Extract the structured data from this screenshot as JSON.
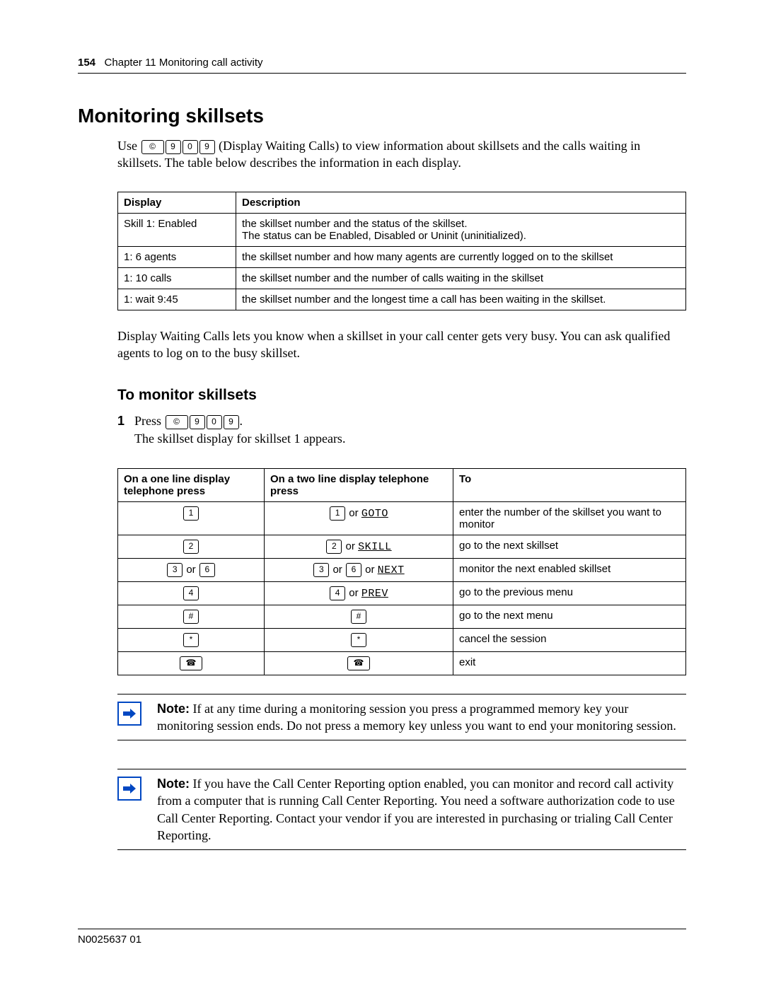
{
  "header": {
    "page_number": "154",
    "chapter": "Chapter 11  Monitoring call activity"
  },
  "title": "Monitoring skillsets",
  "intro": {
    "prefix": "Use",
    "feature_keys": [
      "©",
      "9",
      "0",
      "9"
    ],
    "after_keys": "(Display Waiting Calls) to view information about skillsets and the calls waiting in skillsets. The table below describes the information in each display."
  },
  "table1": {
    "headers": [
      "Display",
      "Description"
    ],
    "rows": [
      [
        "Skill 1: Enabled",
        "the skillset number and the status of the skillset.\nThe status can be Enabled, Disabled or Uninit (uninitialized)."
      ],
      [
        "1: 6 agents",
        "the skillset number and how many agents are currently logged on to the skillset"
      ],
      [
        "1: 10 calls",
        "the skillset number and the number of calls waiting in the skillset"
      ],
      [
        "1: wait 9:45",
        "the skillset number and the longest time a call has been waiting in the skillset."
      ]
    ]
  },
  "para_after_table1": "Display Waiting Calls lets you know when a skillset in your call center gets very busy. You can ask qualified agents to log on to the busy skillset.",
  "subheading": "To monitor skillsets",
  "step": {
    "number": "1",
    "press_label": "Press",
    "keys": [
      "©",
      "9",
      "0",
      "9"
    ],
    "period": ".",
    "line2": "The skillset display for skillset 1 appears."
  },
  "table2": {
    "headers": [
      "On a one line display telephone press",
      "On a two line display telephone press",
      "To"
    ],
    "rows": [
      {
        "c1": [
          "1"
        ],
        "c2_keys": [
          "1"
        ],
        "c2_soft": "GOTO",
        "c3": "enter the number of the skillset you want to monitor"
      },
      {
        "c1": [
          "2"
        ],
        "c2_keys": [
          "2"
        ],
        "c2_soft": "SKILL",
        "c3": "go to the next skillset"
      },
      {
        "c1": [
          "3",
          "or",
          "6"
        ],
        "c2_keys": [
          "3",
          "or",
          "6"
        ],
        "c2_soft": "NEXT",
        "c3": "monitor the next enabled skillset"
      },
      {
        "c1": [
          "4"
        ],
        "c2_keys": [
          "4"
        ],
        "c2_soft": "PREV",
        "c3": "go to the previous menu"
      },
      {
        "c1": [
          "#"
        ],
        "c2_keys": [
          "#"
        ],
        "c2_soft": "",
        "c3": "go to the next menu"
      },
      {
        "c1": [
          "*"
        ],
        "c2_keys": [
          "*"
        ],
        "c2_soft": "",
        "c3": "cancel the session"
      },
      {
        "c1": [
          "☎"
        ],
        "c2_keys": [
          "☎"
        ],
        "c2_soft": "",
        "c3": "exit",
        "wide": true
      }
    ]
  },
  "note1": {
    "label": "Note:",
    "text": "If at any time during a monitoring session you press a programmed memory key your monitoring session ends. Do not press a memory key unless you want to end your monitoring session."
  },
  "note2": {
    "label": "Note:",
    "text": "If you have the Call Center Reporting option enabled, you can monitor and record call activity from a computer that is running Call Center Reporting. You need a software authorization code to use Call Center Reporting. Contact your vendor if you are interested in purchasing or trialing Call Center Reporting."
  },
  "footer": "N0025637 01"
}
